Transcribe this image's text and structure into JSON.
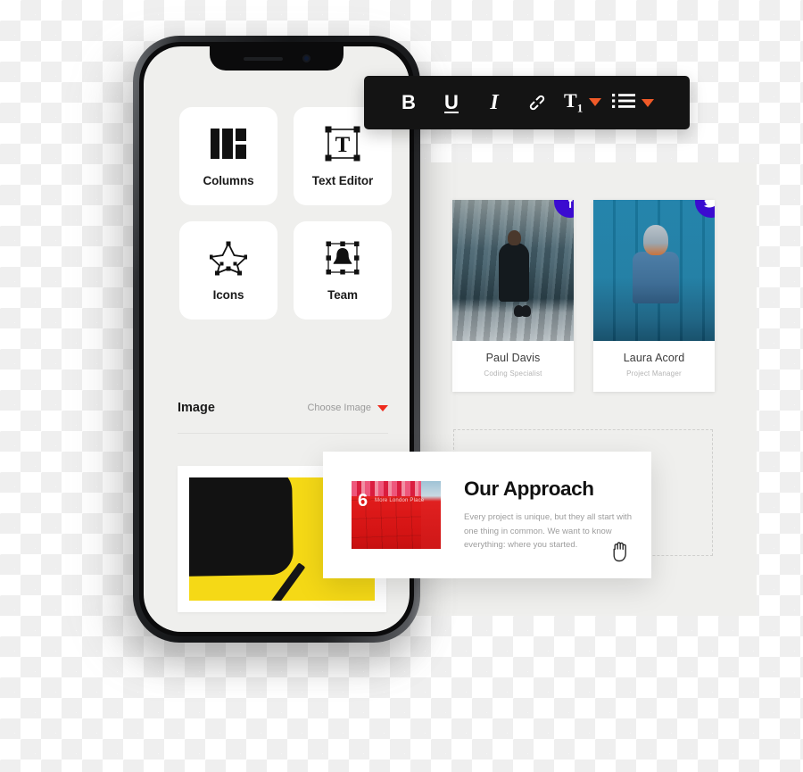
{
  "toolbar": {
    "name": "text-formatting-toolbar",
    "bold_label": "B",
    "underline_label": "U",
    "italic_label": "I",
    "link_icon": "link-icon",
    "heading_label": "T",
    "heading_sub": "1",
    "list_icon": "bulleted-list-icon",
    "caret_icon": "chevron-down-icon",
    "accent_color": "#f05a28",
    "background_color": "#141414"
  },
  "phone": {
    "builder_blocks": [
      {
        "label": "Columns",
        "icon": "columns-layout-icon"
      },
      {
        "label": "Text Editor",
        "icon": "text-editor-icon"
      },
      {
        "label": "Icons",
        "icon": "star-icon"
      },
      {
        "label": "Team",
        "icon": "team-person-icon"
      }
    ],
    "image_section": {
      "label": "Image",
      "choose_label": "Choose Image",
      "caret_icon": "chevron-down-icon",
      "caret_color": "#ef2b1d",
      "preview_alt": "black-tablet-on-yellow-background"
    },
    "screen_background": "#efefed"
  },
  "team_section": {
    "panel_background": "#efefed",
    "members": [
      {
        "name": "Paul Davis",
        "role": "Coding Specialist",
        "social": "facebook-icon",
        "badge_color": "#3b0bd0",
        "photo_alt": "man-in-black-hoodie-in-front-of-glass-building"
      },
      {
        "name": "Laura Acord",
        "role": "Project Manager",
        "social": "twitter-icon",
        "badge_color": "#3b0bd0",
        "photo_alt": "woman-in-denim-jacket-against-teal-wall"
      }
    ],
    "drop_zone": {
      "name": "empty-drop-zone",
      "border_color": "#cfcfcd"
    }
  },
  "approach_card": {
    "title": "Our Approach",
    "text": "Every project is unique, but they all start with one thing in common. We want to know everything: where you started.",
    "thumbnail": {
      "number": "6",
      "caption": "More London Place",
      "alt": "red-scaffolding-building-photo"
    },
    "cursor_icon": "grab-hand-cursor-icon"
  }
}
